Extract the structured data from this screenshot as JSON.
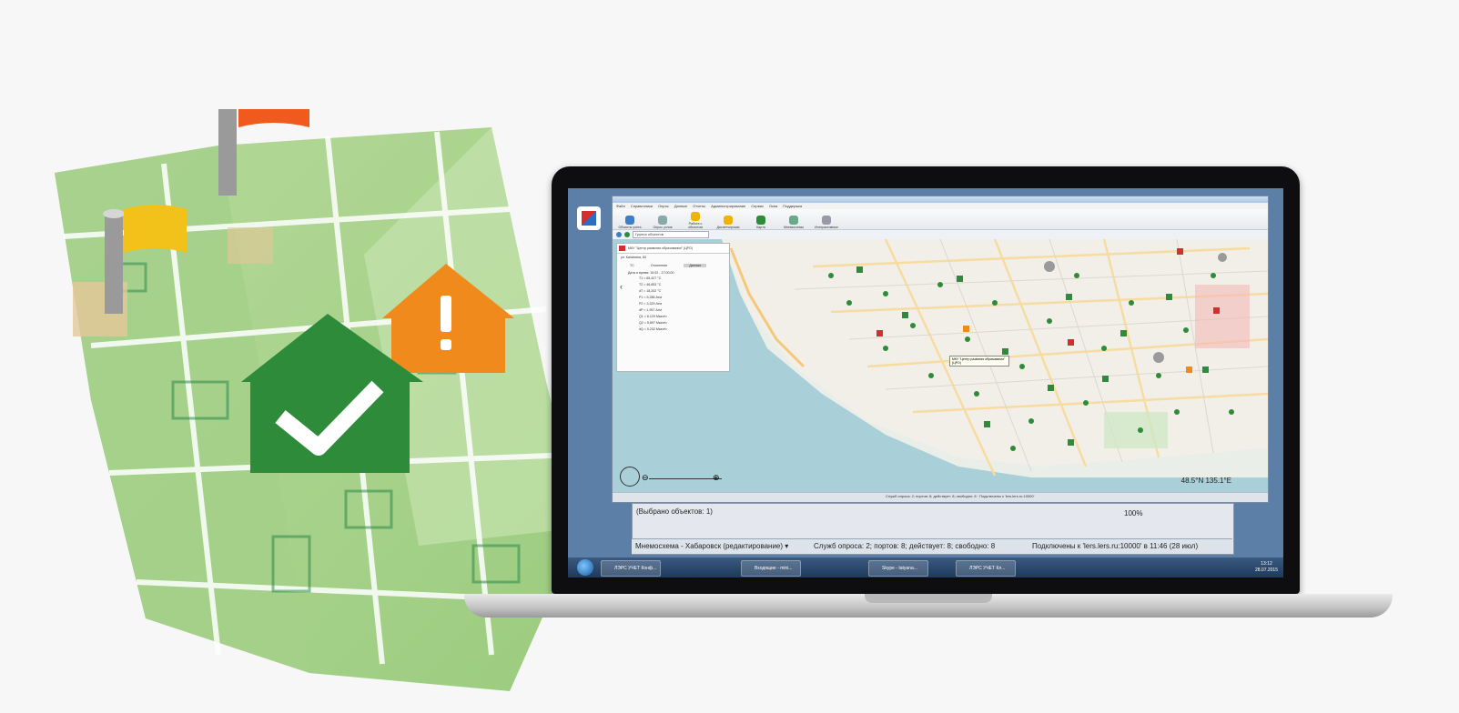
{
  "headline": "",
  "app": {
    "menu": [
      "Файл",
      "Справочники",
      "Опрос",
      "Данные",
      "Отчеты",
      "Администрирование",
      "Сервис",
      "Окна",
      "Поддержка"
    ],
    "ribbon_buttons": [
      "Объекты учета",
      "Опрос узлов",
      "Работа с объектом",
      "Диспетчерская",
      "Карта",
      "Мнемосхемы",
      "Интерактивные"
    ],
    "group_select": "Группа объектов",
    "info_panel": {
      "title": "МКУ \"Центр развития образования\" (ЦРО)",
      "address": "ул. Калинина, 84",
      "tabs": [
        "ТС",
        "Отопление",
        "Данные"
      ],
      "date_label": "Дата и время: 15.02 - 17:00:00",
      "rows": [
        "T1 = 65,427 °C",
        "T2 = 46,653 °C",
        "dT = 18,202 °C",
        "P1 = 5,286 Атм",
        "P2 = 3,329 Атм",
        "dP = 1,957 Атм",
        "Q1 = 6,129 Мкал/ч",
        "Q2 = 5,897 Мкал/ч",
        "dQ = 0,232 Мкал/ч"
      ]
    },
    "tooltip": "МКУ \"Центр развития образования\" (ЦРО)",
    "coords": "48.5°N   135.1°E",
    "status": "Служб опроса: 2; портов: 8; действует: 8; свободно: 8 · Подключены к 'lers.lers.ru:10000'"
  },
  "back_window": {
    "selected_count": "(Выбрано объектов: 1)",
    "zoom": "100%",
    "status_left": "Мнемосхема - Хабаровск (редактирование) ▾",
    "status_mid": "Служб опроса: 2; портов: 8; действует: 8; свободно: 8",
    "status_right": "Подключены к 'lers.lers.ru:10000' в 11:46 (28 июл)"
  },
  "taskbar": {
    "tasks": [
      "ЛЭРС УЧЕТ Конф...",
      "Входящие - mini...",
      "Skype - tatyana...",
      "ЛЭРС УЧЕТ Кл..."
    ],
    "clock_time": "13:12",
    "clock_date": "28.07.2015"
  },
  "colors": {
    "green": "#2e8b3a",
    "orange": "#f08a1c",
    "red": "#d62e2e",
    "map_bg": "#e9eee8"
  }
}
